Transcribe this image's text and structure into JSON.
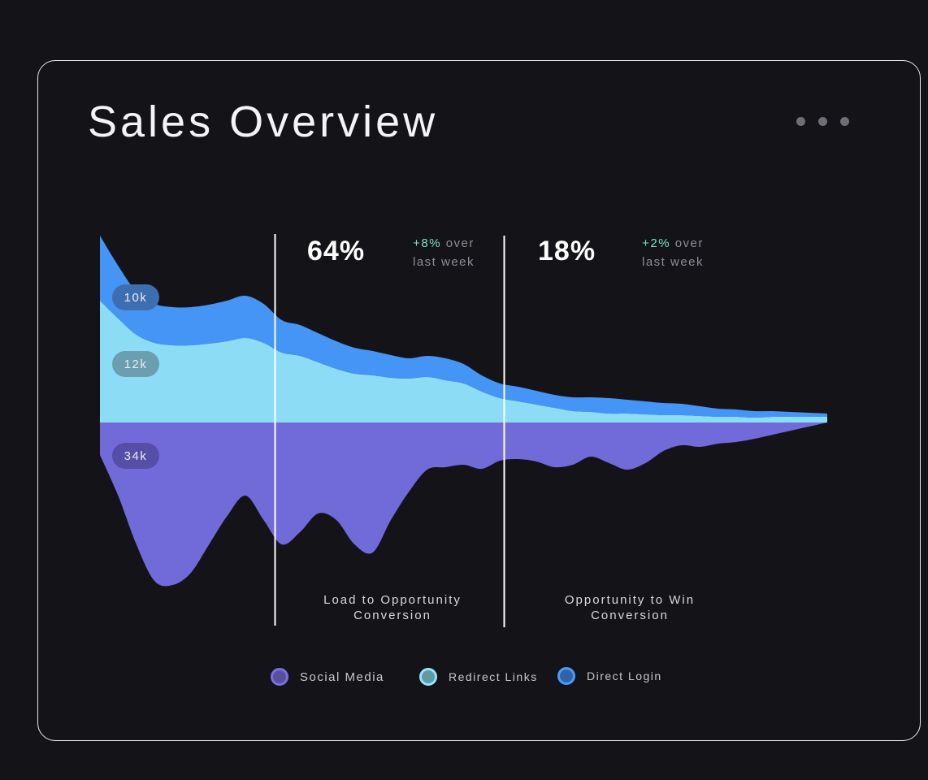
{
  "card": {
    "title": "Sales Overview",
    "menu_icon": "more-horizontal-icon"
  },
  "colors": {
    "background": "#141418",
    "social_media": "#706bd9",
    "redirect_links": "#8ddcf6",
    "direct_login": "#4595f6",
    "delta_positive": "#7ee0c3"
  },
  "stats": [
    {
      "value": "64%",
      "delta": "+8%",
      "delta_suffix": "over",
      "period": "last week"
    },
    {
      "value": "18%",
      "delta": "+2%",
      "delta_suffix": "over",
      "period": "last week"
    }
  ],
  "stages": [
    {
      "label_line1": "Load to Opportunity",
      "label_line2": "Conversion"
    },
    {
      "label_line1": "Opportunity to Win",
      "label_line2": "Conversion"
    }
  ],
  "chart_data": {
    "type": "area",
    "annotations": [
      "10k",
      "12k",
      "34k"
    ],
    "x": [
      0,
      0.5,
      1,
      1.5,
      2,
      2.5,
      3,
      3.5,
      4,
      4.5,
      5,
      5.5,
      6,
      6.5,
      7,
      7.5,
      8,
      8.5,
      9,
      9.5,
      10,
      10.5,
      11,
      11.5,
      12,
      12.5,
      13,
      13.5,
      14,
      14.5,
      15,
      15.5,
      16,
      16.5,
      17,
      17.5,
      18,
      18.5,
      19,
      19.5,
      20
    ],
    "series": [
      {
        "name": "Direct Login",
        "values": [
          80,
          65,
          53,
          48,
          47,
          47,
          48,
          50,
          52,
          48,
          40,
          38,
          36,
          34,
          32,
          30,
          28,
          25,
          26,
          27,
          24,
          20,
          18,
          18,
          17,
          16,
          17,
          18,
          19,
          17,
          16,
          15,
          14,
          12,
          10,
          9,
          8,
          7,
          6,
          5,
          4
        ]
      },
      {
        "name": "Redirect Links",
        "values": [
          150,
          128,
          108,
          98,
          95,
          95,
          97,
          100,
          104,
          98,
          86,
          82,
          74,
          66,
          60,
          58,
          55,
          54,
          56,
          52,
          48,
          38,
          30,
          26,
          22,
          18,
          14,
          13,
          11,
          11,
          10,
          9,
          9,
          8,
          7,
          7,
          6,
          7,
          7,
          7,
          7
        ]
      },
      {
        "name": "Social Media",
        "values": [
          -40,
          -90,
          -150,
          -195,
          -200,
          -185,
          -150,
          -115,
          -90,
          -120,
          -150,
          -135,
          -112,
          -120,
          -150,
          -160,
          -120,
          -85,
          -58,
          -55,
          -52,
          -57,
          -47,
          -45,
          -48,
          -55,
          -52,
          -42,
          -50,
          -58,
          -50,
          -35,
          -28,
          -30,
          -26,
          -24,
          -20,
          -15,
          -10,
          -5,
          0
        ]
      }
    ],
    "legend": [
      "Social Media",
      "Redirect Links",
      "Direct Login"
    ],
    "legend_position": "bottom",
    "grid": false
  },
  "legend": [
    {
      "label": "Social Media",
      "icon": "circle-icon"
    },
    {
      "label": "Redirect Links",
      "icon": "circle-icon"
    },
    {
      "label": "Direct Login",
      "icon": "circle-icon"
    }
  ]
}
